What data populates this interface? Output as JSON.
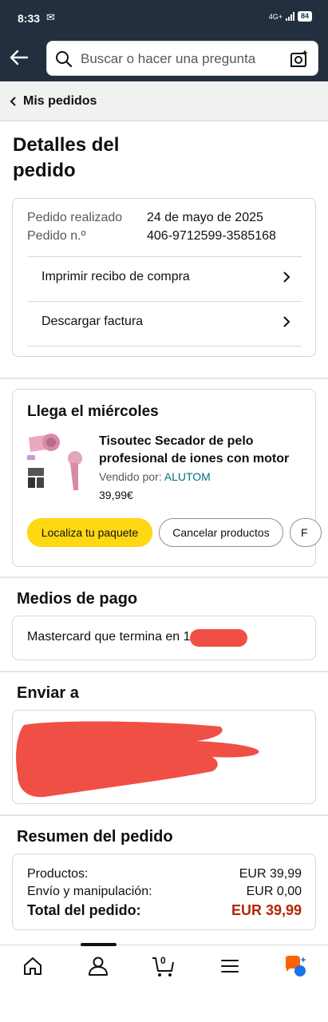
{
  "status_bar": {
    "time": "8:33",
    "network": "4G+",
    "battery": "84"
  },
  "header": {
    "search_placeholder": "Buscar o hacer una pregunta"
  },
  "breadcrumb": {
    "label": "Mis pedidos"
  },
  "page": {
    "title_line1": "Detalles del",
    "title_line2": "pedido"
  },
  "order_info": {
    "placed_label": "Pedido realizado",
    "placed_value": "24 de mayo de 2025",
    "number_label": "Pedido n.º",
    "number_value": "406-9712599-3585168",
    "links": [
      {
        "label": "Imprimir recibo de compra"
      },
      {
        "label": "Descargar factura"
      }
    ]
  },
  "delivery": {
    "title": "Llega el miércoles",
    "product_title_line1": "Tisoutec Secador de pelo",
    "product_title_line2": "profesional de iones con motor",
    "seller_label": "Vendido por:",
    "seller_name": "ALUTOM",
    "price": "39,99€",
    "buttons": {
      "track": "Localiza tu paquete",
      "cancel": "Cancelar productos",
      "partial": "F"
    }
  },
  "payment": {
    "title": "Medios de pago",
    "text": "Mastercard  que termina en 10"
  },
  "shipping": {
    "title": "Enviar a"
  },
  "summary": {
    "title": "Resumen del pedido",
    "products_label": "Productos:",
    "products_value": "EUR 39,99",
    "shipping_label": "Envío y manipulación:",
    "shipping_value": "EUR 0,00",
    "total_label": "Total del pedido:",
    "total_value": "EUR 39,99"
  },
  "bottom_nav": {
    "cart_count": "0",
    "items": [
      "home-icon",
      "account-icon",
      "cart-icon",
      "menu-icon",
      "rufus-icon"
    ]
  },
  "colors": {
    "header_bg": "#232f3e",
    "primary_button": "#ffd814",
    "price_red": "#b12704",
    "link_teal": "#007185",
    "redaction": "#f04f45",
    "rufus_orange": "#ff6200",
    "rufus_blue": "#1a73e8"
  }
}
